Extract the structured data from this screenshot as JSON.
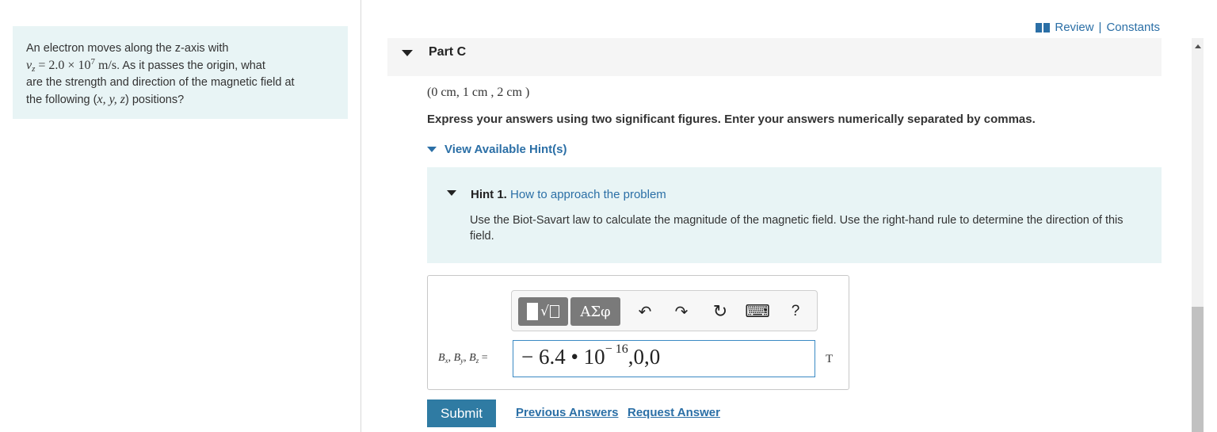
{
  "problem": {
    "line1": "An electron moves along the z-axis with",
    "v_symbol": "v",
    "v_sub": "z",
    "v_eq": " = 2.0 × 10",
    "v_exp": "7",
    "v_unit": " m/s",
    "line2_rest": ". As it passes the origin, what",
    "line3": "are the strength and direction of the magnetic field at",
    "line4_pre": "the following (",
    "line4_vars": "x, y, z",
    "line4_post": ") positions?"
  },
  "topbar": {
    "review": "Review",
    "separator": "|",
    "constants": "Constants",
    "icon": "book-icon"
  },
  "part": {
    "label": "Part C"
  },
  "question": {
    "position": "(0 cm, 1 cm , 2 cm )",
    "instructions": "Express your answers using two significant figures. Enter your answers numerically separated by commas."
  },
  "hints": {
    "toggle_label": "View Available Hint(s)",
    "hint1_number": "Hint 1.",
    "hint1_title": "How to approach the problem",
    "hint1_body": "Use the Biot-Savart law to calculate the magnitude of the magnetic field. Use the right-hand rule to determine the direction of this field."
  },
  "toolbar": {
    "templates_radical": "√",
    "greek_label": "ΑΣφ",
    "undo": "↶",
    "redo": "↷",
    "reset": "↻",
    "keyboard": "⌨",
    "help": "?"
  },
  "answer": {
    "label_B": "B",
    "sub_x": "x",
    "sub_y": "y",
    "sub_z": "z",
    "label_sep": ", ",
    "label_eq": " =",
    "value_main": "− 6.4 • 10",
    "value_exp": "− 16",
    "value_rest": ",0,0",
    "unit": "T"
  },
  "actions": {
    "submit": "Submit",
    "previous_answers": "Previous Answers",
    "request_answer": "Request Answer"
  }
}
